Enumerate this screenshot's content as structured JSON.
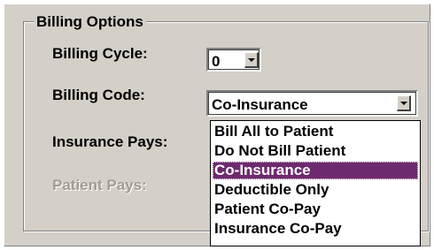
{
  "billing_options": {
    "group_title": "Billing Options",
    "billing_cycle": {
      "label": "Billing Cycle:",
      "value": "0"
    },
    "billing_code": {
      "label": "Billing Code:",
      "value": "Co-Insurance",
      "options": [
        "Bill All to Patient",
        "Do Not Bill Patient",
        "Co-Insurance",
        "Deductible Only",
        "Patient Co-Pay",
        "Insurance Co-Pay"
      ],
      "highlighted": "Co-Insurance"
    },
    "insurance_pays": {
      "label": "Insurance Pays:"
    },
    "patient_pays": {
      "label": "Patient Pays:"
    }
  },
  "colors": {
    "dialog_face": "#d4d0c8",
    "selection_highlight": "#6d2a6e",
    "disabled_text": "#a19c94"
  },
  "icons": {
    "dropdown_arrow": "chevron-down-icon"
  }
}
